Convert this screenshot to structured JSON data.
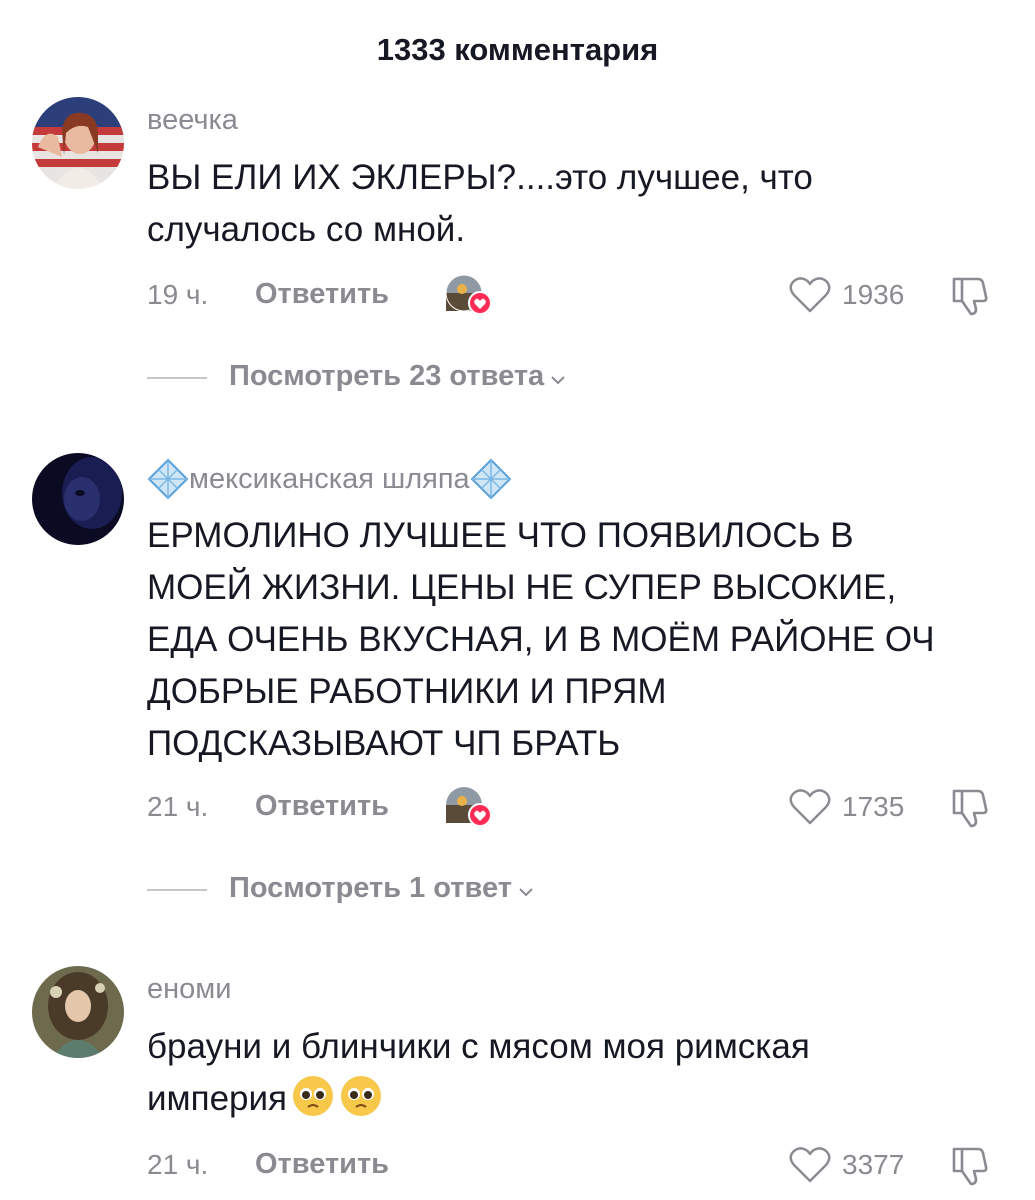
{
  "header": {
    "title": "1333 комментария"
  },
  "comments": [
    {
      "username": "веечка",
      "text": "ВЫ ЕЛИ ИХ ЭКЛЕРЫ?....это лучшее, что\nслучалось со мной.",
      "time": "19 ч.",
      "reply_label": "Ответить",
      "likes": "1936",
      "view_replies": "Посмотреть 23 ответа"
    },
    {
      "username": "мексиканская шляпа",
      "text": "ЕРМОЛИНО ЛУЧШЕЕ ЧТО ПОЯВИЛОСЬ В\nМОЕЙ ЖИЗНИ. ЦЕНЫ НЕ СУПЕР ВЫСОКИЕ,\nЕДА ОЧЕНЬ ВКУСНАЯ, И В МОЁМ РАЙОНЕ ОЧ\nДОБРЫЕ РАБОТНИКИ И ПРЯМ\nПОДСКАЗЫВАЮТ ЧП БРАТЬ",
      "time": "21 ч.",
      "reply_label": "Ответить",
      "likes": "1735",
      "view_replies": "Посмотреть 1 ответ"
    },
    {
      "username": "еноми",
      "text": "брауни и блинчики с мясом моя римская\nимперия",
      "time": "21 ч.",
      "reply_label": "Ответить",
      "likes": "3377"
    }
  ],
  "icons": {
    "like": "heart-outline-icon",
    "dislike": "thumbs-down-icon",
    "creator_liked": "creator-liked-heart-icon",
    "chevron": "chevron-down-icon",
    "username_badge": "diamond-icon",
    "emoji": "pleading-face-emoji"
  },
  "colors": {
    "text": "#161823",
    "secondary": "#8a8b91",
    "heart": "#fe2c55"
  }
}
